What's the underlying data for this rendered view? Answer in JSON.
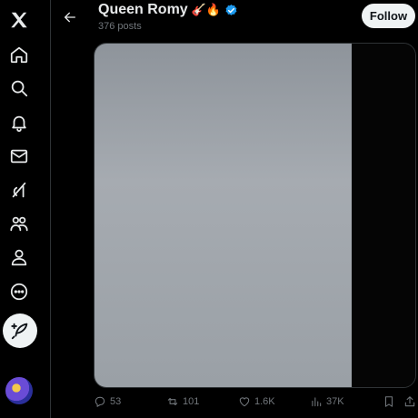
{
  "nav": {
    "items": [
      {
        "name": "x-logo-icon"
      },
      {
        "name": "home-icon"
      },
      {
        "name": "search-icon"
      },
      {
        "name": "notifications-icon"
      },
      {
        "name": "messages-icon"
      },
      {
        "name": "grok-icon"
      },
      {
        "name": "communities-icon"
      },
      {
        "name": "profile-icon"
      },
      {
        "name": "more-icon"
      }
    ],
    "post_button_icon": "feather-plus-icon"
  },
  "header": {
    "name": "Queen Romy",
    "name_emoji": "🎸🔥",
    "post_count": "376 posts",
    "follow_label": "Follow"
  },
  "colors": {
    "background": "#000000",
    "text": "#e7e9ea",
    "muted": "#71767b",
    "verified": "#1d9bf0",
    "button_bg": "#eff3f4"
  },
  "media": {
    "type": "photo"
  },
  "actions": {
    "replies": "53",
    "reposts": "101",
    "likes": "1.6K",
    "views": "37K"
  }
}
